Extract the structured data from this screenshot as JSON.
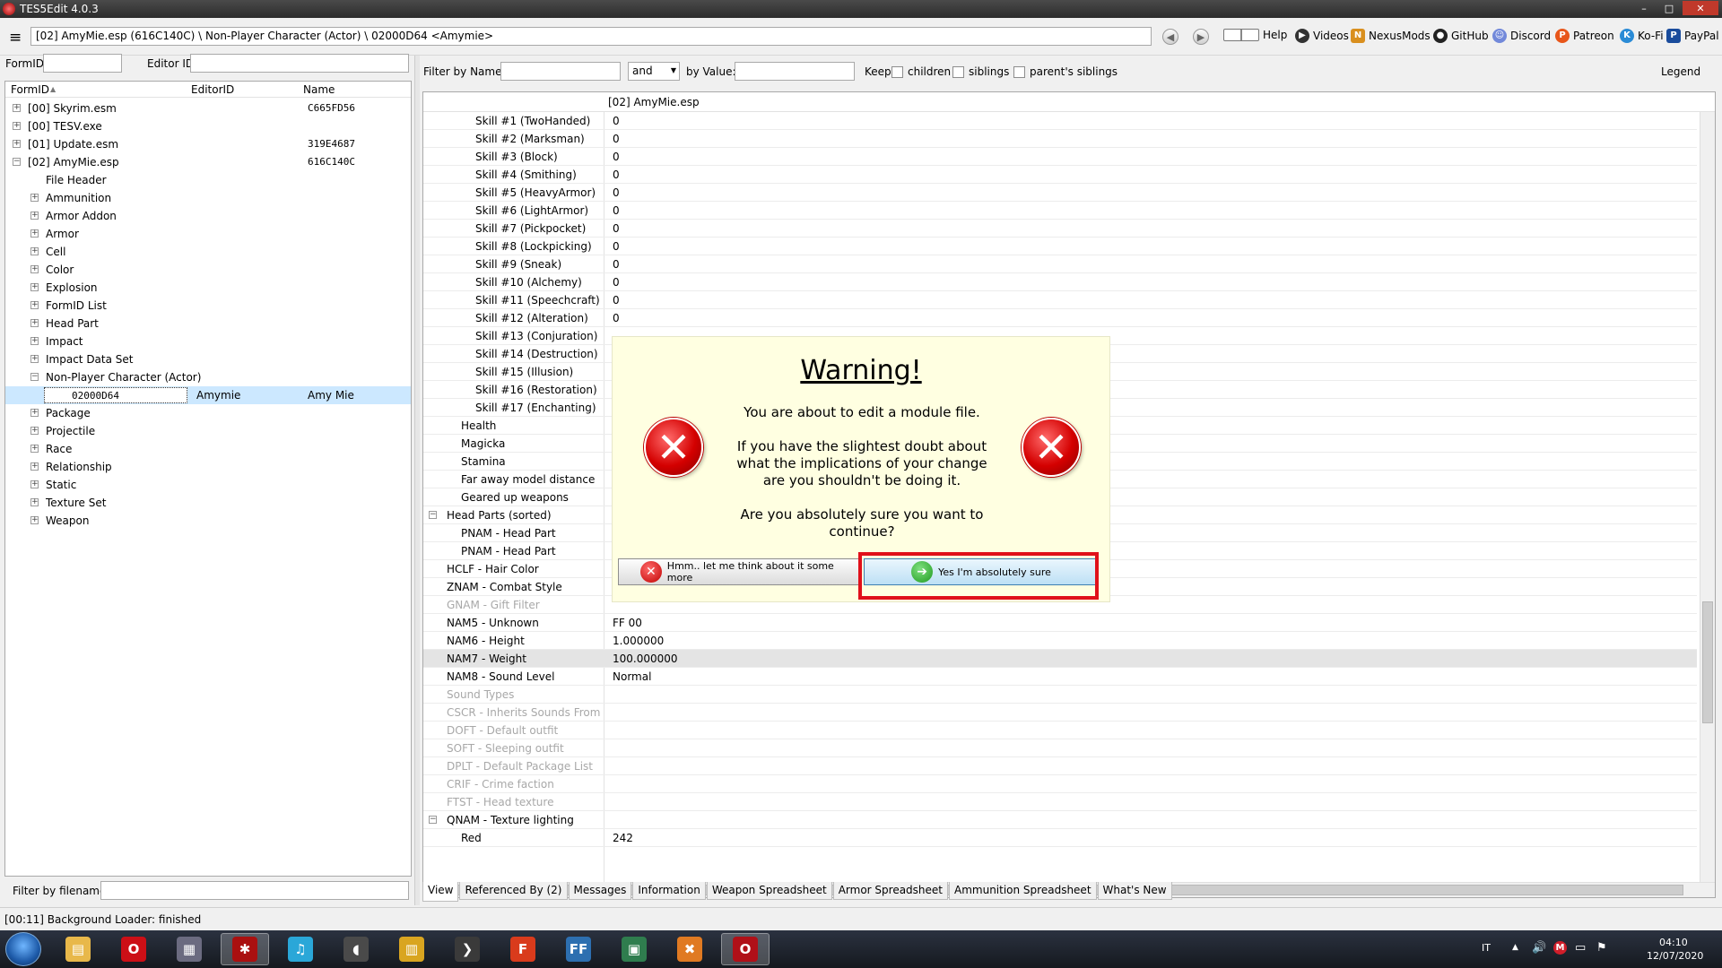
{
  "window": {
    "title": "TES5Edit 4.0.3",
    "controls": [
      "–",
      "□",
      "✕"
    ]
  },
  "toolbar": {
    "menu_glyph": "≡",
    "path": "[02] AmyMie.esp (616C140C) \\ Non-Player Character (Actor) \\ 02000D64 <Amymie>",
    "back_glyph": "◀",
    "forward_glyph": "▶",
    "links": [
      {
        "label": "Help",
        "icon": "book-icon"
      },
      {
        "label": "Videos",
        "icon": "film-icon"
      },
      {
        "label": "NexusMods",
        "icon": "nexus-icon"
      },
      {
        "label": "GitHub",
        "icon": "github-icon"
      },
      {
        "label": "Discord",
        "icon": "discord-icon"
      },
      {
        "label": "Patreon",
        "icon": "patreon-icon"
      },
      {
        "label": "Ko-Fi",
        "icon": "kofi-icon"
      },
      {
        "label": "PayPal",
        "icon": "paypal-icon"
      }
    ]
  },
  "left": {
    "formid_label": "FormID",
    "editorid_label": "Editor ID",
    "columns": [
      "FormID",
      "EditorID",
      "Name"
    ],
    "sort_glyph": "▲",
    "rows": [
      {
        "level": 0,
        "exp": "+",
        "name": "[00] Skyrim.esm",
        "value": "C665FD56"
      },
      {
        "level": 0,
        "exp": "+",
        "name": "[00] TESV.exe",
        "value": ""
      },
      {
        "level": 0,
        "exp": "+",
        "name": "[01] Update.esm",
        "value": "319E4687"
      },
      {
        "level": 0,
        "exp": "−",
        "name": "[02] AmyMie.esp",
        "value": "616C140C"
      },
      {
        "level": 1,
        "exp": "",
        "name": "File Header",
        "value": ""
      },
      {
        "level": 1,
        "exp": "+",
        "name": "Ammunition",
        "value": ""
      },
      {
        "level": 1,
        "exp": "+",
        "name": "Armor Addon",
        "value": ""
      },
      {
        "level": 1,
        "exp": "+",
        "name": "Armor",
        "value": ""
      },
      {
        "level": 1,
        "exp": "+",
        "name": "Cell",
        "value": ""
      },
      {
        "level": 1,
        "exp": "+",
        "name": "Color",
        "value": ""
      },
      {
        "level": 1,
        "exp": "+",
        "name": "Explosion",
        "value": ""
      },
      {
        "level": 1,
        "exp": "+",
        "name": "FormID List",
        "value": ""
      },
      {
        "level": 1,
        "exp": "+",
        "name": "Head Part",
        "value": ""
      },
      {
        "level": 1,
        "exp": "+",
        "name": "Impact",
        "value": ""
      },
      {
        "level": 1,
        "exp": "+",
        "name": "Impact Data Set",
        "value": ""
      },
      {
        "level": 1,
        "exp": "−",
        "name": "Non-Player Character (Actor)",
        "value": ""
      }
    ],
    "selected": {
      "formid": "02000D64",
      "editorid": "Amymie",
      "name": "Amy Mie"
    },
    "rows_after": [
      {
        "exp": "+",
        "name": "Package"
      },
      {
        "exp": "+",
        "name": "Projectile"
      },
      {
        "exp": "+",
        "name": "Race"
      },
      {
        "exp": "+",
        "name": "Relationship"
      },
      {
        "exp": "+",
        "name": "Static"
      },
      {
        "exp": "+",
        "name": "Texture Set"
      },
      {
        "exp": "+",
        "name": "Weapon"
      }
    ],
    "filter_label": "Filter by filename:"
  },
  "right": {
    "filter_name_label": "Filter by Name:",
    "and_value": "and",
    "by_value_label": "by Value:",
    "keep_label": "Keep",
    "children_label": "children",
    "siblings_label": "siblings",
    "parents_siblings_label": "parent's siblings",
    "legend_label": "Legend",
    "grid_header": "[02] AmyMie.esp",
    "rows": [
      {
        "indent": 3,
        "name": "Skill #1 (TwoHanded)",
        "value": "0"
      },
      {
        "indent": 3,
        "name": "Skill #2 (Marksman)",
        "value": "0"
      },
      {
        "indent": 3,
        "name": "Skill #3 (Block)",
        "value": "0"
      },
      {
        "indent": 3,
        "name": "Skill #4 (Smithing)",
        "value": "0"
      },
      {
        "indent": 3,
        "name": "Skill #5 (HeavyArmor)",
        "value": "0"
      },
      {
        "indent": 3,
        "name": "Skill #6 (LightArmor)",
        "value": "0"
      },
      {
        "indent": 3,
        "name": "Skill #7 (Pickpocket)",
        "value": "0"
      },
      {
        "indent": 3,
        "name": "Skill #8 (Lockpicking)",
        "value": "0"
      },
      {
        "indent": 3,
        "name": "Skill #9 (Sneak)",
        "value": "0"
      },
      {
        "indent": 3,
        "name": "Skill #10 (Alchemy)",
        "value": "0"
      },
      {
        "indent": 3,
        "name": "Skill #11 (Speechcraft)",
        "value": "0"
      },
      {
        "indent": 3,
        "name": "Skill #12 (Alteration)",
        "value": "0"
      },
      {
        "indent": 3,
        "name": "Skill #13 (Conjuration)",
        "value": ""
      },
      {
        "indent": 3,
        "name": "Skill #14 (Destruction)",
        "value": ""
      },
      {
        "indent": 3,
        "name": "Skill #15 (Illusion)",
        "value": ""
      },
      {
        "indent": 3,
        "name": "Skill #16 (Restoration)",
        "value": ""
      },
      {
        "indent": 3,
        "name": "Skill #17 (Enchanting)",
        "value": ""
      },
      {
        "indent": 2,
        "name": "Health",
        "value": ""
      },
      {
        "indent": 2,
        "name": "Magicka",
        "value": ""
      },
      {
        "indent": 2,
        "name": "Stamina",
        "value": ""
      },
      {
        "indent": 2,
        "name": "Far away model distance",
        "value": ""
      },
      {
        "indent": 2,
        "name": "Geared up weapons",
        "value": ""
      },
      {
        "indent": 1,
        "exp": "−",
        "name": "Head Parts (sorted)",
        "value": ""
      },
      {
        "indent": 2,
        "name": "PNAM - Head Part",
        "value": ""
      },
      {
        "indent": 2,
        "name": "PNAM - Head Part",
        "value": ""
      },
      {
        "indent": 1,
        "name": "HCLF - Hair Color",
        "value": ""
      },
      {
        "indent": 1,
        "name": "ZNAM - Combat Style",
        "value": ""
      },
      {
        "indent": 1,
        "name": "GNAM - Gift Filter",
        "value": "",
        "dim": true
      },
      {
        "indent": 1,
        "name": "NAM5 - Unknown",
        "value": "FF 00"
      },
      {
        "indent": 1,
        "name": "NAM6 - Height",
        "value": "1.000000"
      },
      {
        "indent": 1,
        "name": "NAM7 - Weight",
        "value": "100.000000",
        "hl": true
      },
      {
        "indent": 1,
        "name": "NAM8 - Sound Level",
        "value": "Normal"
      },
      {
        "indent": 1,
        "name": "Sound Types",
        "value": "",
        "dim": true
      },
      {
        "indent": 1,
        "name": "CSCR - Inherits Sounds From",
        "value": "",
        "dim": true
      },
      {
        "indent": 1,
        "name": "DOFT - Default outfit",
        "value": "",
        "dim": true
      },
      {
        "indent": 1,
        "name": "SOFT - Sleeping outfit",
        "value": "",
        "dim": true
      },
      {
        "indent": 1,
        "name": "DPLT - Default Package List",
        "value": "",
        "dim": true
      },
      {
        "indent": 1,
        "name": "CRIF - Crime faction",
        "value": "",
        "dim": true
      },
      {
        "indent": 1,
        "name": "FTST - Head texture",
        "value": "",
        "dim": true
      },
      {
        "indent": 1,
        "exp": "−",
        "name": "QNAM - Texture lighting",
        "value": ""
      },
      {
        "indent": 2,
        "name": "Red",
        "value": "242"
      }
    ],
    "tabs": [
      "View",
      "Referenced By (2)",
      "Messages",
      "Information",
      "Weapon Spreadsheet",
      "Armor Spreadsheet",
      "Ammunition Spreadsheet",
      "What's New"
    ]
  },
  "dialog": {
    "title": "Warning!",
    "line1": "You are about to edit a module file.",
    "line2": "If you have the slightest doubt about",
    "line3": "what the implications of your change",
    "line4": "are you shouldn't be doing it.",
    "line5": "Are you absolutely sure you want to",
    "line6": "continue?",
    "x_glyph": "✕",
    "cancel_label": "Hmm.. let me think about it some more",
    "confirm_label": "Yes I'm absolutely sure",
    "arrow_glyph": "➔",
    "highlight_color": "#e0101a"
  },
  "status": {
    "text": "[00:11] Background Loader: finished"
  },
  "taskbar": {
    "apps": [
      {
        "name": "explorer",
        "glyph": "▤",
        "color": "#e8b84a"
      },
      {
        "name": "opera",
        "glyph": "O",
        "color": "#cc0f16"
      },
      {
        "name": "media-center",
        "glyph": "▦",
        "color": "#6b6b80"
      },
      {
        "name": "tes5edit",
        "glyph": "✱",
        "color": "#aa1010",
        "active": true
      },
      {
        "name": "music",
        "glyph": "♫",
        "color": "#2aa7d8"
      },
      {
        "name": "audio",
        "glyph": "◖",
        "color": "#4a4a4a"
      },
      {
        "name": "folder-app",
        "glyph": "▥",
        "color": "#d9a520"
      },
      {
        "name": "arrow-app",
        "glyph": "❯",
        "color": "#3a3a3a"
      },
      {
        "name": "fences",
        "glyph": "F",
        "color": "#d93b1c"
      },
      {
        "name": "ffdec",
        "glyph": "FF",
        "color": "#2d6fb0"
      },
      {
        "name": "window-app",
        "glyph": "▣",
        "color": "#2f7d4e"
      },
      {
        "name": "puzzle-app",
        "glyph": "✖",
        "color": "#e07a22"
      },
      {
        "name": "opera-gx",
        "glyph": "O",
        "color": "#b01018",
        "active": true
      }
    ],
    "lang": "IT",
    "time": "04:10",
    "date": "12/07/2020"
  }
}
